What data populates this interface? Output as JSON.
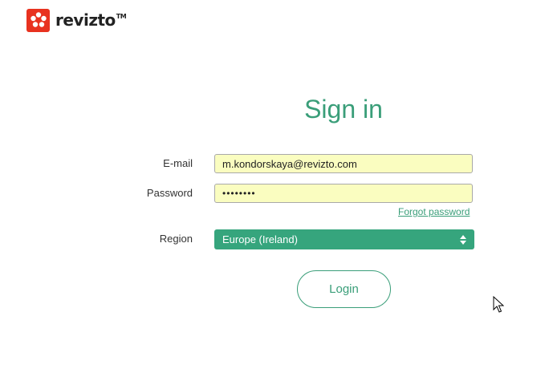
{
  "brand": {
    "name": "revizto",
    "tm": "TM",
    "color": "#e8321f"
  },
  "form": {
    "title": "Sign in",
    "email_label": "E-mail",
    "email_value": "m.kondorskaya@revizto.com",
    "password_label": "Password",
    "password_value": "••••••••",
    "forgot_label": "Forgot password",
    "region_label": "Region",
    "region_value": "Europe (Ireland)",
    "login_label": "Login"
  },
  "colors": {
    "accent": "#3a9e79",
    "select_bg": "#36a57d",
    "autofill_bg": "#fafdc0"
  }
}
